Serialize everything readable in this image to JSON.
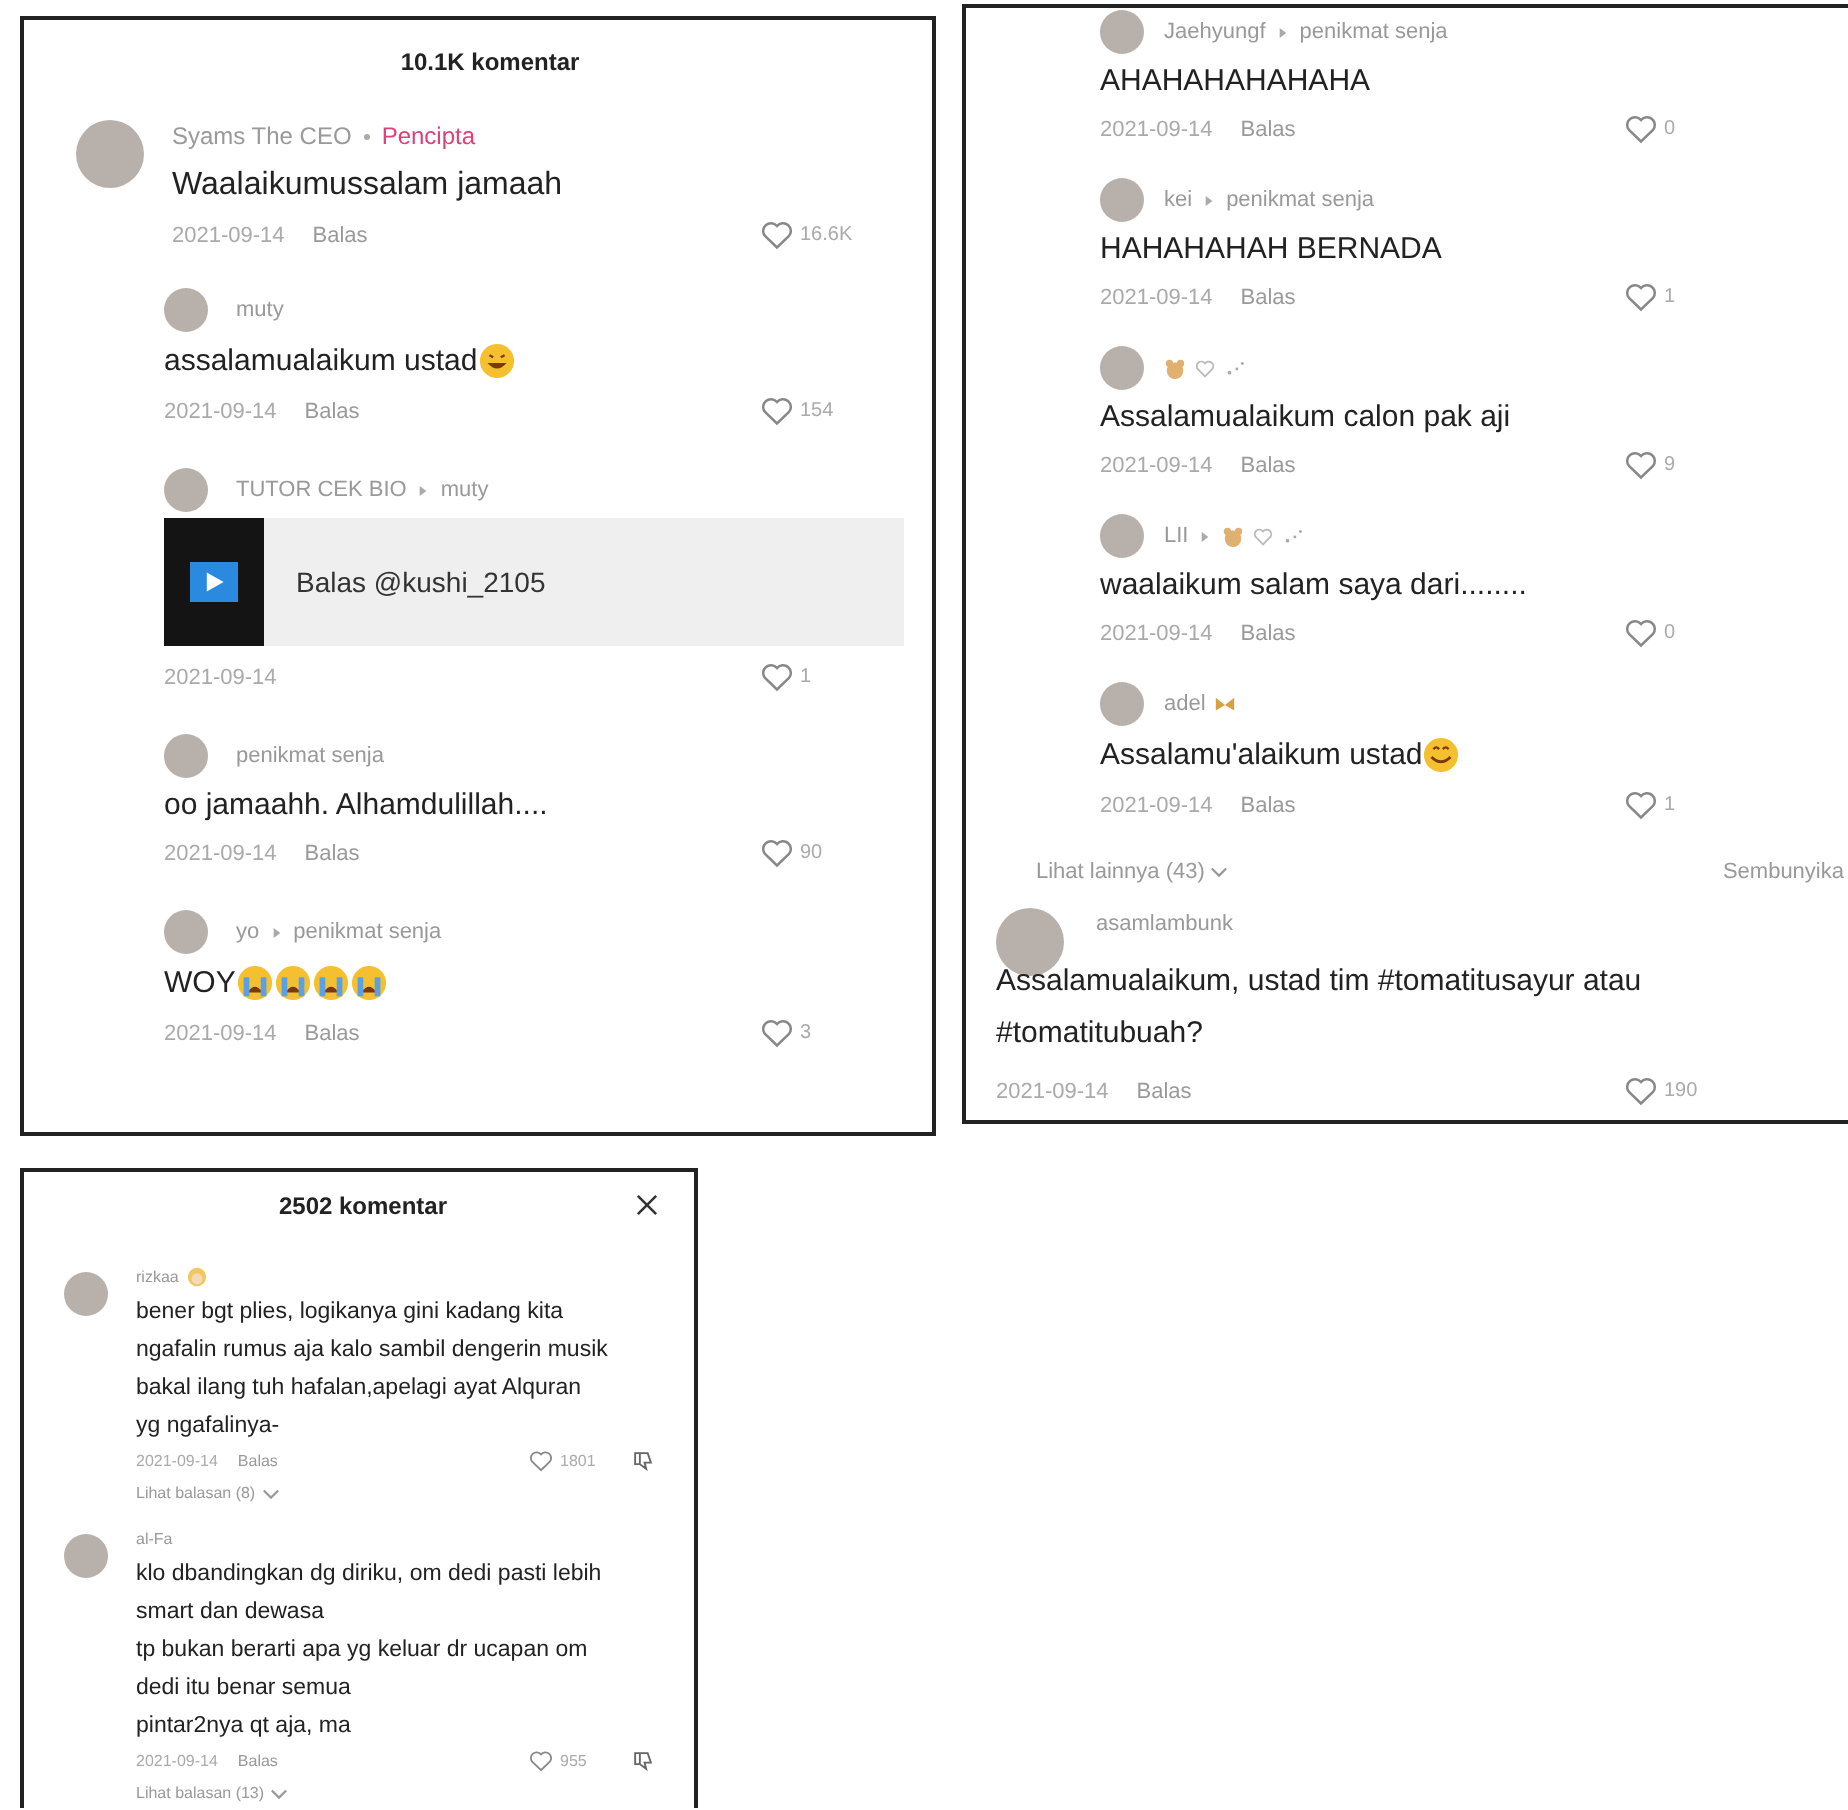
{
  "panels": [
    {
      "title": "10.1K komentar",
      "comments": [
        {
          "author": {
            "name": "Syams The CEO"
          },
          "badge": "Pencipta",
          "text": "Waalaikumussalam jamaah",
          "date": "2021-09-14",
          "reply": "Balas",
          "likes": "16.6K",
          "children": [
            {
              "author": {
                "name": "muty"
              },
              "text": "assalamualaikum ustad",
              "emojis": [
                {
                  "kind": "grin"
                }
              ],
              "date": "2021-09-14",
              "reply": "Balas",
              "likes": "154"
            },
            {
              "author": {
                "name": "TUTOR CEK BIO"
              },
              "reply_to": {
                "name": "muty"
              },
              "attachment": {
                "text": "Balas @kushi_2105"
              },
              "date": "2021-09-14",
              "likes": "1"
            },
            {
              "author": {
                "name": "penikmat senja"
              },
              "text": "oo jamaahh. Alhamdulillah....",
              "date": "2021-09-14",
              "reply": "Balas",
              "likes": "90"
            },
            {
              "author": {
                "name": "yo"
              },
              "reply_to": {
                "name": "penikmat senja"
              },
              "text": "WOY",
              "emojis": [
                {
                  "kind": "cry"
                },
                {
                  "kind": "cry"
                },
                {
                  "kind": "cry"
                },
                {
                  "kind": "cry"
                }
              ],
              "date": "2021-09-14",
              "reply": "Balas",
              "likes": "3"
            }
          ]
        }
      ]
    },
    {
      "replies": [
        {
          "author": {
            "name": "Jaehyungf"
          },
          "reply_to": {
            "name": "penikmat senja"
          },
          "text": "AHAHAHAHAHAHA",
          "date": "2021-09-14",
          "reply": "Balas",
          "likes": "0"
        },
        {
          "author": {
            "name": "kei"
          },
          "reply_to": {
            "name": "penikmat senja"
          },
          "text": "HAHAHAHAH BERNADA",
          "date": "2021-09-14",
          "reply": "Balas",
          "likes": "1"
        },
        {
          "author": {
            "decor": [
              {
                "kind": "bear"
              },
              {
                "kind": "heart"
              },
              {
                "kind": "sparkle"
              }
            ]
          },
          "text": "Assalamualaikum calon pak aji",
          "date": "2021-09-14",
          "reply": "Balas",
          "likes": "9"
        },
        {
          "author": {
            "name": "LII"
          },
          "reply_to": {
            "decor": [
              {
                "kind": "bear"
              },
              {
                "kind": "heart"
              },
              {
                "kind": "sparkle"
              }
            ]
          },
          "text": "waalaikum salam saya dari........",
          "date": "2021-09-14",
          "reply": "Balas",
          "likes": "0"
        },
        {
          "author": {
            "name": "adel",
            "decor": [
              {
                "kind": "butterfly"
              }
            ]
          },
          "text": "Assalamu'alaikum ustad",
          "emojis": [
            {
              "kind": "smile"
            }
          ],
          "date": "2021-09-14",
          "reply": "Balas",
          "likes": "1"
        }
      ],
      "more_link": "Lihat lainnya (43)",
      "hide_link": "Sembunyika",
      "comments": [
        {
          "author": {
            "name": "asamlambunk"
          },
          "text": "Assalamualaikum, ustad tim #tomatitusayur atau #tomatitubuah?",
          "date": "2021-09-14",
          "reply": "Balas",
          "likes": "190"
        }
      ]
    },
    {
      "title": "2502 komentar",
      "comments": [
        {
          "author": {
            "name": "rizkaa",
            "decor": [
              {
                "kind": "blonde"
              }
            ]
          },
          "text": "bener bgt plies, logikanya gini kadang kita\nngafalin rumus aja kalo sambil dengerin musik\nbakal ilang tuh hafalan,apelagi ayat Alquran\nyg ngafalinya-",
          "date": "2021-09-14",
          "reply": "Balas",
          "likes": "1801",
          "dislike_button": true,
          "more_link": "Lihat balasan (8)"
        },
        {
          "author": {
            "name": "al-Fa"
          },
          "text": "klo dbandingkan dg diriku, om dedi pasti lebih\nsmart dan dewasa\ntp bukan berarti apa yg keluar dr ucapan om\ndedi itu benar semua\npintar2nya qt aja, ma",
          "date": "2021-09-14",
          "reply": "Balas",
          "likes": "955",
          "dislike_button": true,
          "more_link": "Lihat balasan (13)"
        }
      ]
    }
  ]
}
